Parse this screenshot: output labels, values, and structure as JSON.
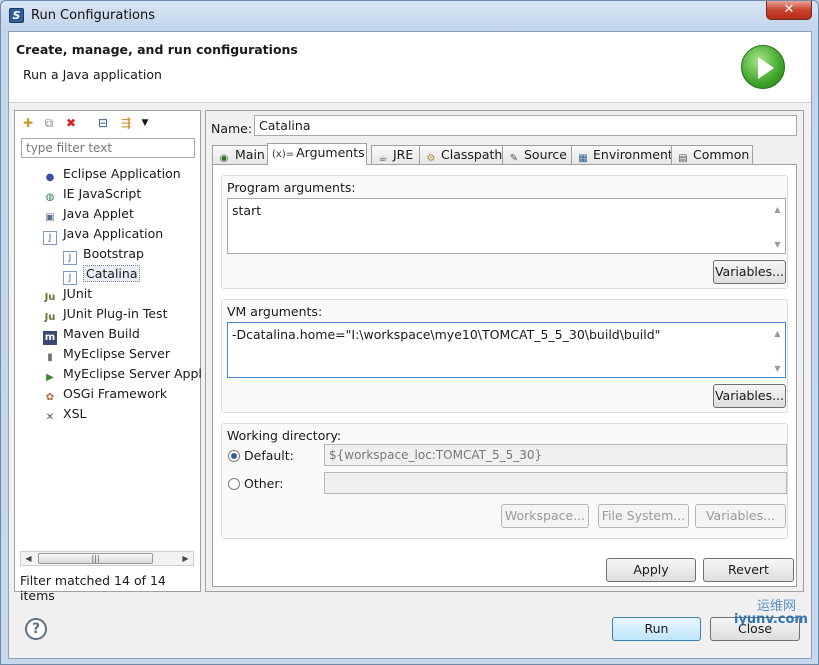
{
  "window": {
    "title": "Run Configurations",
    "close_glyph": "✕"
  },
  "header": {
    "title": "Create, manage, and run configurations",
    "subtitle": "Run a Java application"
  },
  "left": {
    "filter_placeholder": "type filter text",
    "tree": [
      {
        "label": "Eclipse Application",
        "icon": "eclipse-icon",
        "glyph": "●",
        "color": "#3b4fa3"
      },
      {
        "label": "IE JavaScript",
        "icon": "globe-icon",
        "glyph": "◍",
        "color": "#2f7a4d"
      },
      {
        "label": "Java Applet",
        "icon": "applet-icon",
        "glyph": "▣",
        "color": "#5a6d8c"
      },
      {
        "label": "Java Application",
        "icon": "java-app-icon",
        "glyph": "J",
        "color": "#3a6ea5"
      },
      {
        "label": "Bootstrap",
        "icon": "java-app-icon",
        "glyph": "J",
        "color": "#3a6ea5"
      },
      {
        "label": "Catalina",
        "icon": "java-app-icon",
        "glyph": "J",
        "color": "#3a6ea5"
      },
      {
        "label": "JUnit",
        "icon": "junit-icon",
        "glyph": "Ju",
        "color": "#5b7a2a"
      },
      {
        "label": "JUnit Plug-in Test",
        "icon": "junit-plugin-icon",
        "glyph": "Ju",
        "color": "#5b7a2a"
      },
      {
        "label": "Maven Build",
        "icon": "maven-icon",
        "glyph": "m",
        "color": "#ffffff"
      },
      {
        "label": "MyEclipse Server",
        "icon": "server-icon",
        "glyph": "▮",
        "color": "#707070"
      },
      {
        "label": "MyEclipse Server Appl",
        "icon": "server-app-icon",
        "glyph": "▶",
        "color": "#3d8a2e"
      },
      {
        "label": "OSGi Framework",
        "icon": "osgi-icon",
        "glyph": "✿",
        "color": "#b0612a"
      },
      {
        "label": "XSL",
        "icon": "xsl-icon",
        "glyph": "✕",
        "color": "#555555"
      }
    ],
    "status": "Filter matched 14 of 14 items"
  },
  "config": {
    "name_label": "Name:",
    "name_value": "Catalina",
    "tabs": [
      {
        "label": "Main",
        "icon": "main-tab-icon",
        "glyph": "◉"
      },
      {
        "label": "Arguments",
        "icon": "arguments-tab-icon",
        "glyph": "(x)="
      },
      {
        "label": "JRE",
        "icon": "jre-tab-icon",
        "glyph": "☕"
      },
      {
        "label": "Classpath",
        "icon": "classpath-tab-icon",
        "glyph": "⚙"
      },
      {
        "label": "Source",
        "icon": "source-tab-icon",
        "glyph": "✎"
      },
      {
        "label": "Environment",
        "icon": "environment-tab-icon",
        "glyph": "▦"
      },
      {
        "label": "Common",
        "icon": "common-tab-icon",
        "glyph": "▤"
      }
    ],
    "program_args_label": "Program arguments:",
    "program_args_value": "start",
    "vm_args_label": "VM arguments:",
    "vm_args_value": "-Dcatalina.home=\"I:\\workspace\\mye10\\TOMCAT_5_5_30\\build\\build\"",
    "variables_label": "Variables...",
    "workdir_label": "Working directory:",
    "default_label": "Default:",
    "default_value": "${workspace_loc:TOMCAT_5_5_30}",
    "other_label": "Other:",
    "other_value": "",
    "workspace_btn": "Workspace...",
    "filesystem_btn": "File System...",
    "variables_btn": "Variables...",
    "apply": "Apply",
    "revert": "Revert"
  },
  "footer": {
    "help": "?",
    "run": "Run",
    "close": "Close"
  },
  "watermark": {
    "line1": "运维网",
    "line2": "iyunv.com"
  }
}
